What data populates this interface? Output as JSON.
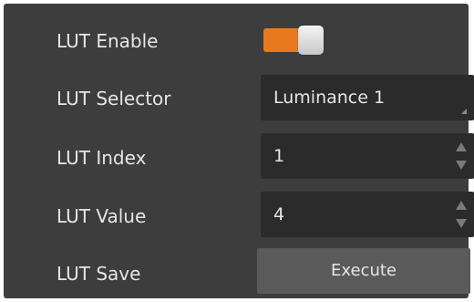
{
  "lut_enable": {
    "label": "LUT Enable",
    "value": true,
    "accent_color": "#e8791e"
  },
  "lut_selector": {
    "label": "LUT Selector",
    "value": "Luminance 1"
  },
  "lut_index": {
    "label": "LUT Index",
    "value": "1"
  },
  "lut_value": {
    "label": "LUT Value",
    "value": "4"
  },
  "lut_save": {
    "label": "LUT Save",
    "button_label": "Execute"
  }
}
